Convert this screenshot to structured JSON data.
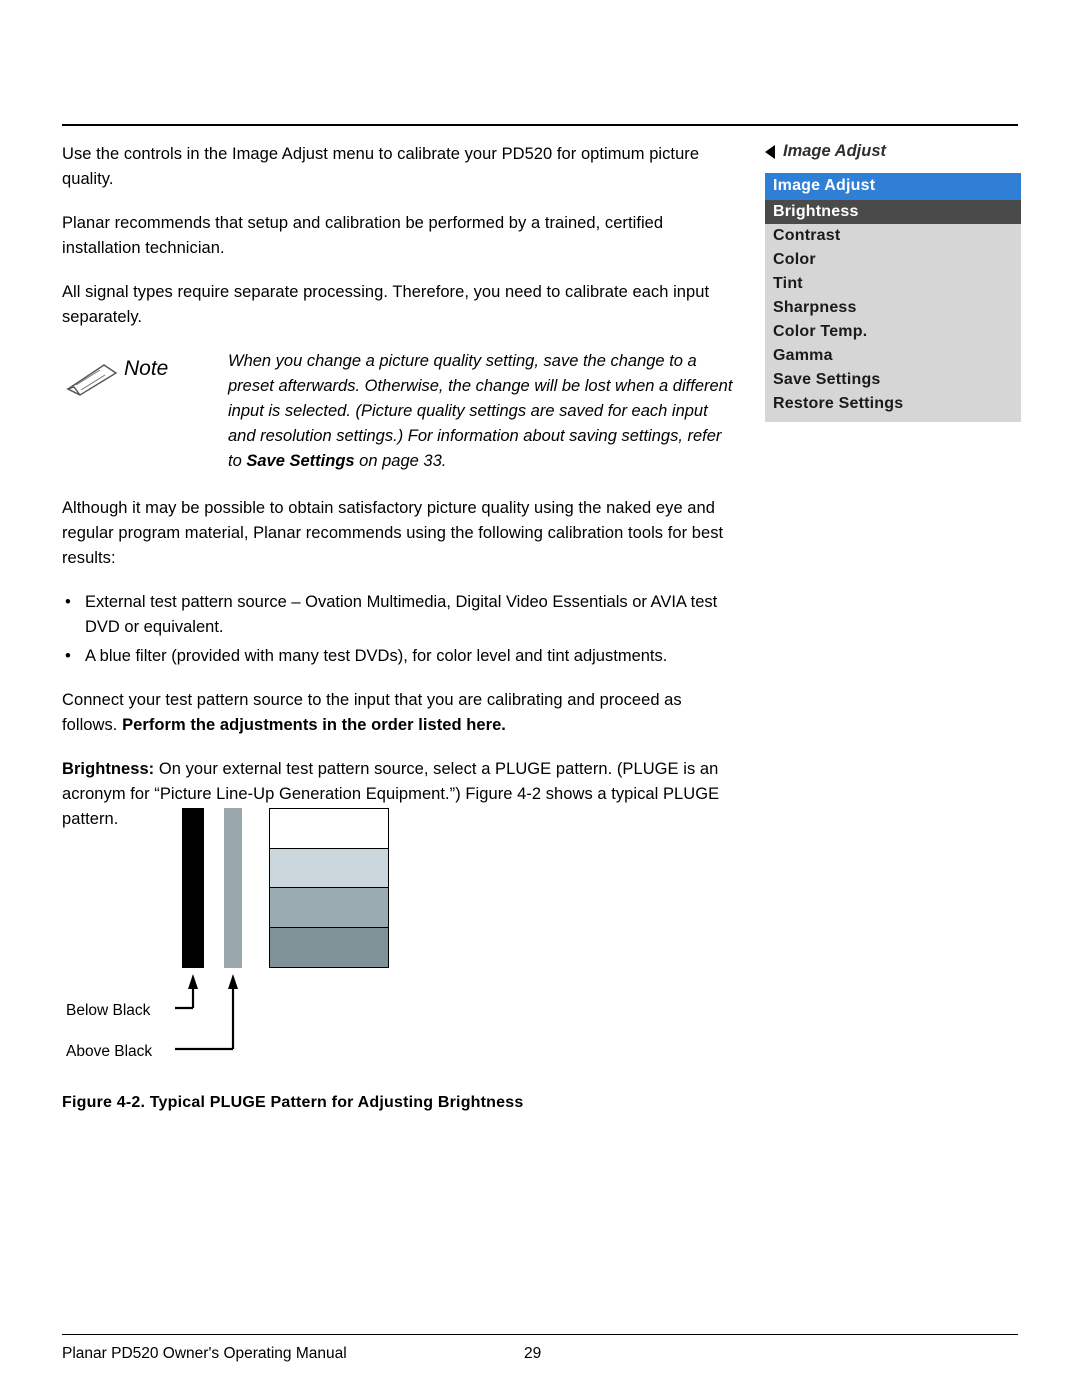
{
  "body": {
    "p1": "Use the controls in the Image Adjust menu to calibrate your PD520 for optimum picture quality.",
    "p2": "Planar recommends that setup and calibration be performed by a trained, certified installation technician.",
    "p3": "All signal types require separate processing. Therefore, you need to calibrate each input separately.",
    "p4": "Although it may be possible to obtain satisfactory picture quality using the naked eye and regular program material, Planar recommends using the following calibration tools for best results:",
    "bullet1": "External test pattern source – Ovation Multimedia, Digital Video Essentials or AVIA test DVD or equivalent.",
    "bullet2": "A blue filter (provided with many test DVDs), for color level and tint adjustments.",
    "p5_plain": "Connect your test pattern source to the input that you are calibrating and proceed as follows. ",
    "p5_bold": "Perform the adjustments in the order listed here.",
    "p6_bold": "Brightness:",
    "p6_plain": " On your external test pattern source, select a PLUGE pattern. (PLUGE is an acronym for “Picture Line-Up Generation Equipment.”) Figure 4-2 shows a typical PLUGE pattern."
  },
  "note": {
    "label": "Note",
    "text_1": "When you change a picture quality setting, save the change to a preset afterwards. Otherwise, the change will be lost when a different input is selected. (Picture quality settings are saved for each input and resolution settings.) For information about saving settings, refer to ",
    "text_bold": "Save Settings",
    "text_2": " on page 33."
  },
  "osd": {
    "caption": "Image Adjust",
    "title": "Image Adjust",
    "items": [
      {
        "label": "Brightness",
        "selected": true
      },
      {
        "label": "Contrast",
        "selected": false
      },
      {
        "label": "Color",
        "selected": false
      },
      {
        "label": "Tint",
        "selected": false
      },
      {
        "label": "Sharpness",
        "selected": false
      },
      {
        "label": "Color Temp.",
        "selected": false
      },
      {
        "label": "Gamma",
        "selected": false
      },
      {
        "label": "Save Settings",
        "selected": false
      },
      {
        "label": "Restore Settings",
        "selected": false
      }
    ]
  },
  "figure": {
    "label_below": "Below Black",
    "label_above": "Above Black",
    "caption": "Figure 4-2. Typical PLUGE Pattern for Adjusting Brightness"
  },
  "footer": {
    "left": "Planar PD520 Owner's Operating Manual",
    "page": "29"
  }
}
